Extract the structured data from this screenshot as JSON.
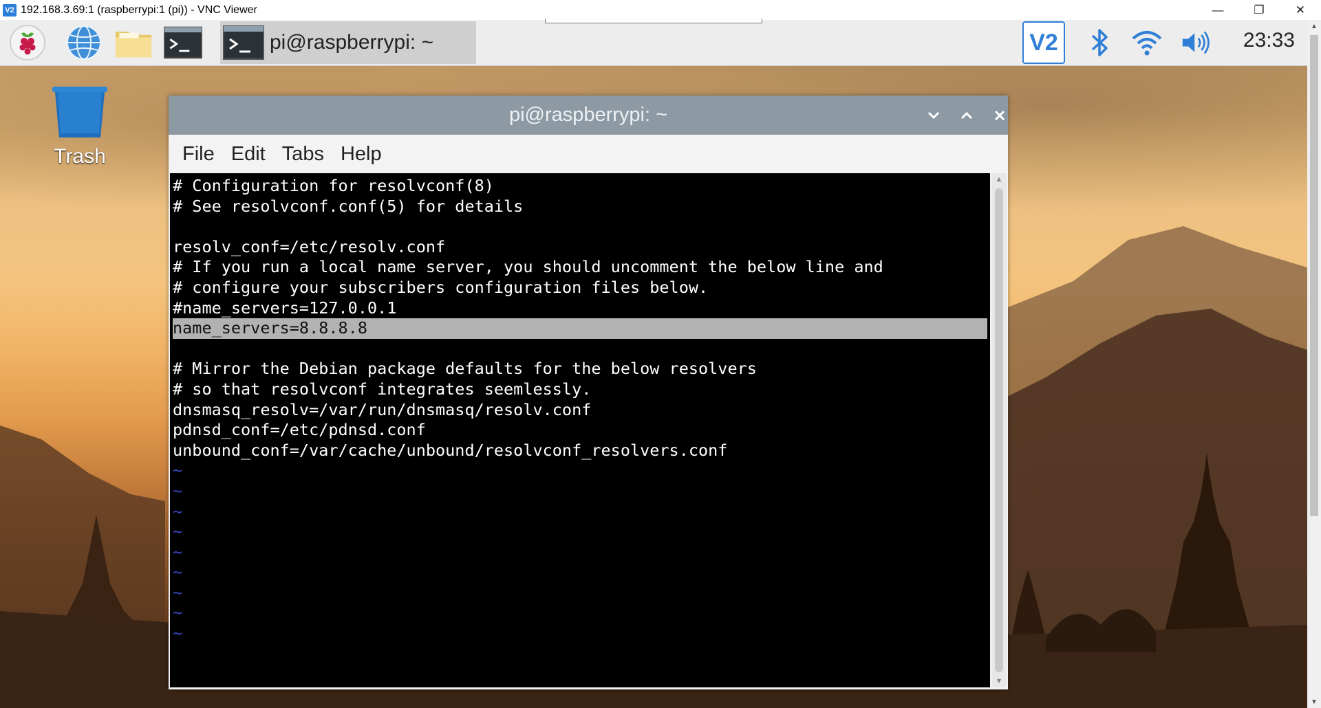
{
  "vnc": {
    "logo": "V2",
    "title": "192.168.3.69:1 (raspberrypi:1 (pi)) - VNC Viewer",
    "minimize": "—",
    "restore": "❐",
    "close": "✕"
  },
  "taskbar": {
    "launchers": [
      "raspberry-menu-icon",
      "web-browser-icon",
      "file-manager-icon",
      "terminal-icon"
    ],
    "task_label": "pi@raspberrypi: ~",
    "tray": [
      "vnc-server-icon",
      "bluetooth-icon",
      "wifi-icon",
      "volume-icon"
    ],
    "vnc_tray_text": "V2",
    "clock": "23:33"
  },
  "desktop": {
    "trash_label": "Trash"
  },
  "terminal": {
    "title": "pi@raspberrypi: ~",
    "menu": [
      "File",
      "Edit",
      "Tabs",
      "Help"
    ],
    "lines": [
      "# Configuration for resolvconf(8)",
      "# See resolvconf.conf(5) for details",
      "",
      "resolv_conf=/etc/resolv.conf",
      "# If you run a local name server, you should uncomment the below line and",
      "# configure your subscribers configuration files below.",
      "#name_servers=127.0.0.1",
      "name_servers=8.8.8.8",
      "",
      "# Mirror the Debian package defaults for the below resolvers",
      "# so that resolvconf integrates seemlessly.",
      "dnsmasq_resolv=/var/run/dnsmasq/resolv.conf",
      "pdnsd_conf=/etc/pdnsd.conf",
      "unbound_conf=/var/cache/unbound/resolvconf_resolvers.conf",
      "~",
      "~",
      "~",
      "~",
      "~",
      "~",
      "~",
      "~",
      "~"
    ],
    "highlighted_line": 7
  },
  "colors": {
    "titlebar": "#8d9aa3",
    "highlight": "#b2b2b2",
    "tilde": "#3a49c8",
    "vnc_blue": "#2f7fd6"
  }
}
